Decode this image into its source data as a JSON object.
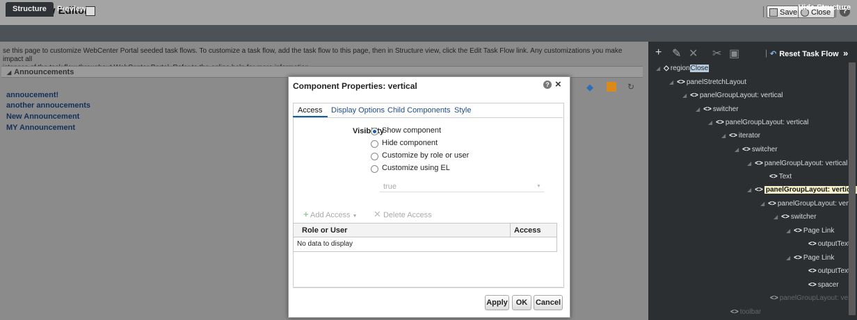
{
  "header": {
    "title": "Task Flow Editor",
    "save_label": "Save",
    "close_label": "Close",
    "help_icon": "question-icon"
  },
  "tabs": {
    "structure": "Structure",
    "preview": "Preview",
    "hide_structure": "Hide Structure"
  },
  "page": {
    "intro_line1": "se this page to customize WebCenter Portal seeded task flows. To customize a task flow, add the task flow to this page, then in Structure view, click the Edit Task Flow link. Any customizations you make impact all",
    "intro_line2": "istances of the task flow throughout WebCenter Portal. Refer to the online help for more information.",
    "announcements_header": "Announcements",
    "announcements": [
      "annoucement!",
      "another annoucements",
      "New Announcement",
      "MY Announcement"
    ]
  },
  "structure_panel": {
    "reset_label": "Reset Task Flow",
    "expand_label": "»",
    "nodes": [
      {
        "label": "region",
        "badge": "Close"
      },
      {
        "label": "panelStretchLayout"
      },
      {
        "label": "panelGroupLayout: vertical"
      },
      {
        "label": "switcher"
      },
      {
        "label": "panelGroupLayout: vertical"
      },
      {
        "label": "iterator"
      },
      {
        "label": "switcher"
      },
      {
        "label": "panelGroupLayout: vertical"
      },
      {
        "label": "Text"
      },
      {
        "label": "panelGroupLayout: vertical"
      },
      {
        "label": "panelGroupLayout: vert"
      },
      {
        "label": "switcher"
      },
      {
        "label": "Page Link"
      },
      {
        "label": "outputText"
      },
      {
        "label": "Page Link"
      },
      {
        "label": "outputText"
      },
      {
        "label": "spacer"
      },
      {
        "label": "panelGroupLayout: vert"
      },
      {
        "label": "toolbar"
      }
    ]
  },
  "dialog": {
    "title": "Component Properties: vertical",
    "tabs": [
      "Access",
      "Display Options",
      "Child Components",
      "Style"
    ],
    "visibility_label": "Visibility",
    "options": [
      "Show component",
      "Hide component",
      "Customize by role or user",
      "Customize using EL"
    ],
    "selected_option": "Show component",
    "el_value": "true",
    "add_access": "Add Access",
    "delete_access": "Delete Access",
    "col_role": "Role or User",
    "col_access": "Access",
    "empty_text": "No data to display",
    "apply": "Apply",
    "ok": "OK",
    "cancel": "Cancel"
  }
}
